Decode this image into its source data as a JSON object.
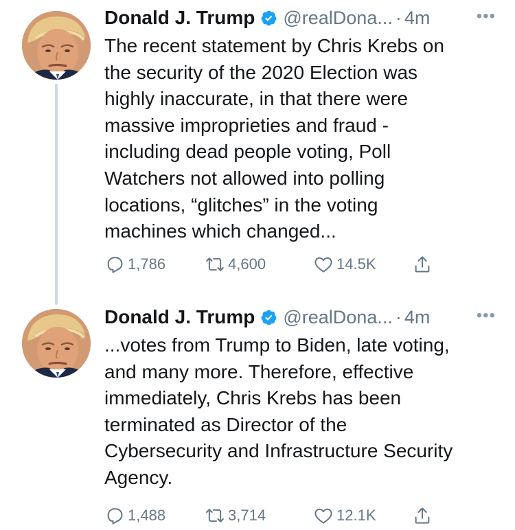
{
  "tweets": [
    {
      "author_name": "Donald J. Trump",
      "handle": "@realDona...",
      "separator": "·",
      "time": "4m",
      "more": "•••",
      "text": "The recent statement by Chris Krebs on\nthe security of the 2020 Election was\nhighly inaccurate, in that there were\nmassive improprieties and fraud -\nincluding dead people voting, Poll\nWatchers not allowed into polling\nlocations, “glitches” in the voting\nmachines which changed...",
      "replies": "1,786",
      "retweets": "4,600",
      "likes": "14.5K"
    },
    {
      "author_name": "Donald J. Trump",
      "handle": "@realDona...",
      "separator": "·",
      "time": "4m",
      "more": "•••",
      "text": "...votes from Trump to Biden, late voting,\nand many more. Therefore, effective\nimmediately, Chris Krebs has been\nterminated as Director of the\nCybersecurity and Infrastructure Security\nAgency.",
      "replies": "1,488",
      "retweets": "3,714",
      "likes": "12.1K"
    }
  ],
  "icons": {
    "verified": "verified-badge-icon",
    "reply": "reply-icon",
    "retweet": "retweet-icon",
    "like": "heart-icon",
    "share": "share-icon"
  },
  "colors": {
    "verified": "#1da1f2",
    "secondary_text": "#657786",
    "primary_text": "#14171a",
    "thread_line": "#cfd9de"
  }
}
